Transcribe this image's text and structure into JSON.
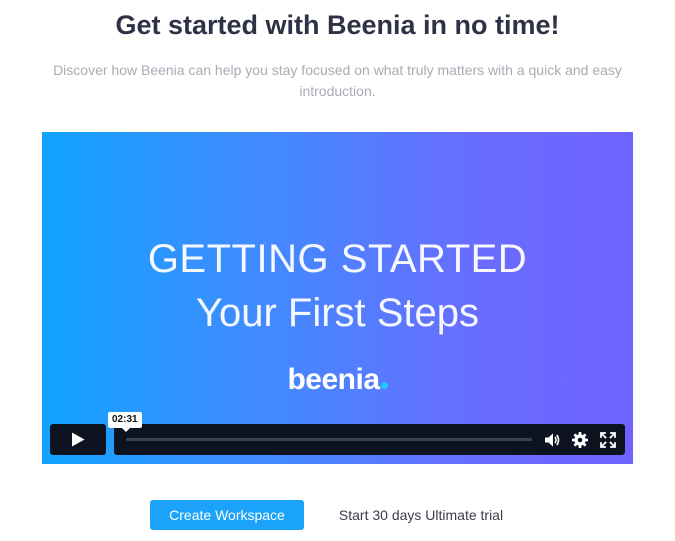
{
  "header": {
    "title": "Get started with Beenia in no time!",
    "subtitle": "Discover how Beenia can help you stay focused on what truly matters with a quick and easy introduction."
  },
  "video": {
    "headline": "GETTING STARTED",
    "subheadline": "Your First Steps",
    "logo_text": "beenia",
    "duration_tooltip": "02:31",
    "gradient_colors": [
      "#13a3ff",
      "#6f63ff"
    ],
    "controls": {
      "play_icon": "play-icon",
      "volume_icon": "volume-icon",
      "settings_icon": "gear-icon",
      "fullscreen_icon": "fullscreen-icon"
    }
  },
  "actions": {
    "create_label": "Create Workspace",
    "trial_label": "Start 30 days Ultimate trial",
    "accent_color": "#1aa3f8"
  }
}
